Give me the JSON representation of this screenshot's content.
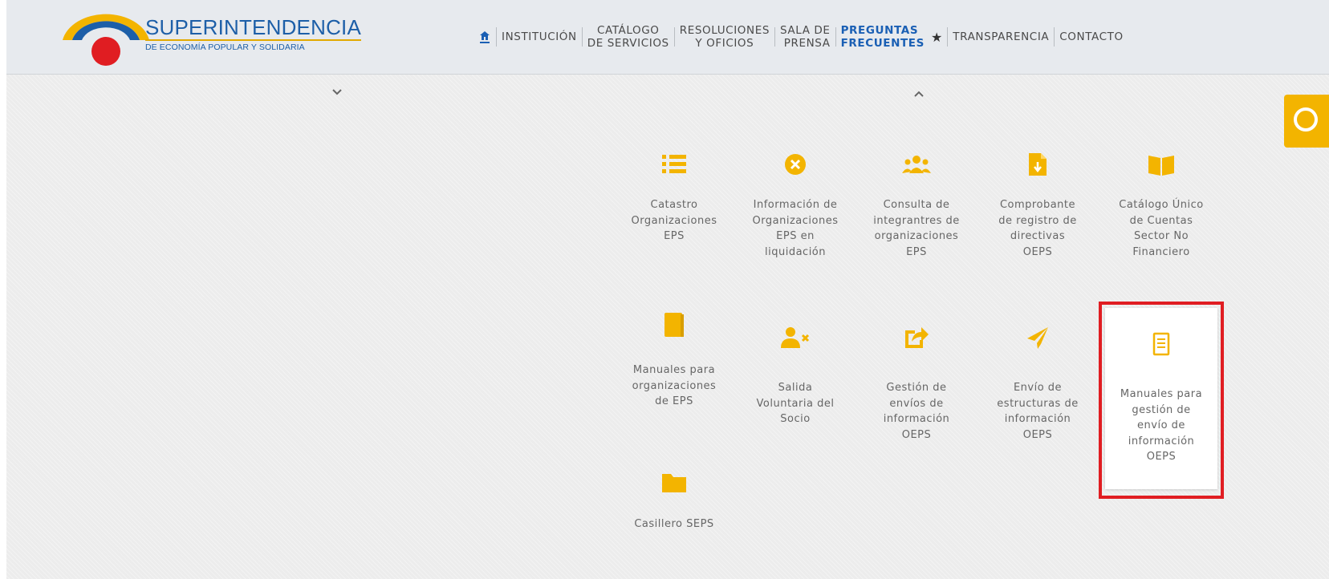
{
  "header": {
    "logo_title": "SUPERINTENDENCIA",
    "logo_subtitle": "DE ECONOMÍA POPULAR Y SOLIDARIA",
    "nav": [
      {
        "line1": "INSTITUCIÓN",
        "line2": ""
      },
      {
        "line1": "CATÁLOGO",
        "line2": "DE SERVICIOS"
      },
      {
        "line1": "RESOLUCIONES",
        "line2": "Y OFICIOS"
      },
      {
        "line1": "SALA DE",
        "line2": "PRENSA"
      },
      {
        "line1": "PREGUNTAS",
        "line2": "FRECUENTES"
      },
      {
        "line1": "TRANSPARENCIA",
        "line2": ""
      },
      {
        "line1": "CONTACTO",
        "line2": ""
      }
    ],
    "icons": {
      "home": "home-icon",
      "star": "star-icon"
    }
  },
  "accent_color": "#f3b400",
  "highlight_color": "#e01d22",
  "tiles": [
    {
      "icon": "list-icon",
      "lines": [
        "Catastro",
        "Organizaciones",
        "EPS"
      ]
    },
    {
      "icon": "x-circle-icon",
      "lines": [
        "Información de",
        "Organizaciones",
        "EPS en",
        "liquidación"
      ]
    },
    {
      "icon": "users-icon",
      "lines": [
        "Consulta de",
        "integrantres de",
        "organizaciones",
        "EPS"
      ]
    },
    {
      "icon": "file-download-icon",
      "lines": [
        "Comprobante",
        "de registro de",
        "directivas",
        "OEPS"
      ]
    },
    {
      "icon": "book-open-icon",
      "lines": [
        "Catálogo Único",
        "de Cuentas",
        "Sector No",
        "Financiero"
      ]
    },
    {
      "icon": "book-icon",
      "lines": [
        "Manuales para",
        "organizaciones",
        "de EPS"
      ]
    },
    {
      "icon": "user-remove-icon",
      "lines": [
        "Salida",
        "Voluntaria del",
        "Socio"
      ]
    },
    {
      "icon": "share-icon",
      "lines": [
        "Gestión de",
        "envíos de",
        "información",
        "OEPS"
      ]
    },
    {
      "icon": "paper-plane-icon",
      "lines": [
        "Envío de",
        "estructuras de",
        "información",
        "OEPS"
      ]
    },
    {
      "icon": "document-icon",
      "lines": [
        "Manuales para",
        "gestión de",
        "envío de",
        "información",
        "OEPS"
      ]
    },
    {
      "icon": "folder-icon",
      "lines": [
        "Casillero SEPS"
      ]
    }
  ]
}
